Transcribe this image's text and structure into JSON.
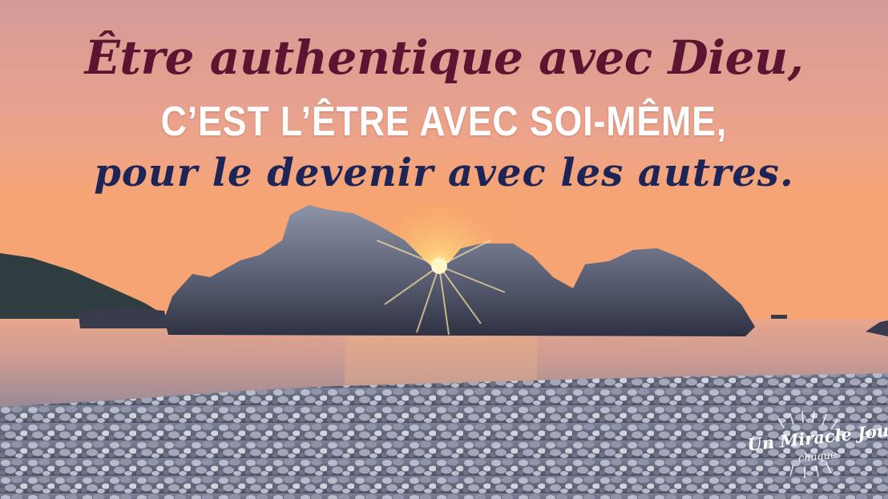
{
  "quote": {
    "line1": "Être authentique avec Dieu,",
    "line2": "C’EST L’ÊTRE AVEC SOI-MÊME,",
    "line3": "pour le devenir avec les autres."
  },
  "logo": {
    "line1": "Un Miracle Jour",
    "line2": "chaque"
  },
  "colors": {
    "sky_top": "#d79a96",
    "sky_horizon": "#f4a070",
    "sea": "#e9a98e",
    "line1_text": "#5a1630",
    "line2_text": "#ffffff",
    "line3_text": "#1d2456",
    "sun": "#fff6c8"
  }
}
